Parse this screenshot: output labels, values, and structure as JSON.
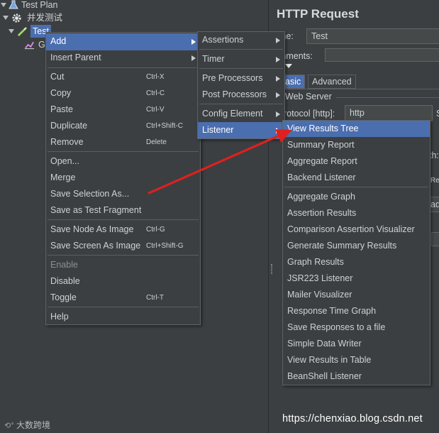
{
  "tree": {
    "nodes": [
      {
        "label": "Test Plan"
      },
      {
        "label": "并发测试"
      },
      {
        "label": "Test"
      },
      {
        "label": "G"
      }
    ]
  },
  "right_panel": {
    "title": "HTTP Request",
    "name_label": "ame:",
    "name_value": "Test",
    "comments_label": "omments:",
    "tabs": [
      "asic",
      "Advanced"
    ],
    "web_server_label": "Web Server",
    "protocol_label": "rotocol [http]:",
    "protocol_value": "http",
    "cut_s": "S",
    "cut_th": "th:",
    "cut_re": "Re",
    "cut_ad": "ad"
  },
  "context_menu": {
    "items": [
      {
        "label": "Add",
        "accel": ""
      },
      {
        "label": "Insert Parent",
        "accel": ""
      },
      {
        "label": "Cut",
        "accel": "Ctrl-X"
      },
      {
        "label": "Copy",
        "accel": "Ctrl-C"
      },
      {
        "label": "Paste",
        "accel": "Ctrl-V"
      },
      {
        "label": "Duplicate",
        "accel": "Ctrl+Shift-C"
      },
      {
        "label": "Remove",
        "accel": "Delete"
      },
      {
        "label": "Open...",
        "accel": ""
      },
      {
        "label": "Merge",
        "accel": ""
      },
      {
        "label": "Save Selection As...",
        "accel": ""
      },
      {
        "label": "Save as Test Fragment",
        "accel": ""
      },
      {
        "label": "Save Node As Image",
        "accel": "Ctrl-G"
      },
      {
        "label": "Save Screen As Image",
        "accel": "Ctrl+Shift-G"
      },
      {
        "label": "Enable",
        "accel": ""
      },
      {
        "label": "Disable",
        "accel": ""
      },
      {
        "label": "Toggle",
        "accel": "Ctrl-T"
      },
      {
        "label": "Help",
        "accel": ""
      }
    ]
  },
  "add_menu": {
    "items": [
      {
        "label": "Assertions"
      },
      {
        "label": "Timer"
      },
      {
        "label": "Pre Processors"
      },
      {
        "label": "Post Processors"
      },
      {
        "label": "Config Element"
      },
      {
        "label": "Listener"
      }
    ]
  },
  "listener_menu": {
    "items": [
      {
        "label": "View Results Tree"
      },
      {
        "label": "Summary Report"
      },
      {
        "label": "Aggregate Report"
      },
      {
        "label": "Backend Listener"
      },
      {
        "label": "Aggregate Graph"
      },
      {
        "label": "Assertion Results"
      },
      {
        "label": "Comparison Assertion Visualizer"
      },
      {
        "label": "Generate Summary Results"
      },
      {
        "label": "Graph Results"
      },
      {
        "label": "JSR223 Listener"
      },
      {
        "label": "Mailer Visualizer"
      },
      {
        "label": "Response Time Graph"
      },
      {
        "label": "Save Responses to a file"
      },
      {
        "label": "Simple Data Writer"
      },
      {
        "label": "View Results in Table"
      },
      {
        "label": "BeanShell Listener"
      }
    ]
  },
  "watermarks": {
    "right": "https://chenxiao.blog.csdn.net",
    "left": "大数跨境"
  },
  "colors": {
    "background": "#3c3f41",
    "highlight": "#4b6eaf",
    "annotation_arrow": "#e0201e"
  }
}
